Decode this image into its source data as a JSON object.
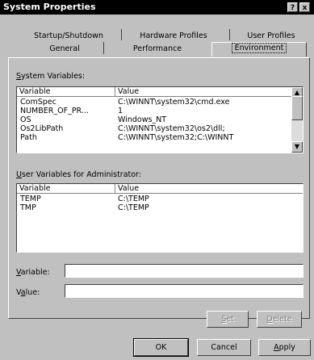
{
  "window": {
    "title": "System Properties",
    "help_glyph": "?",
    "close_glyph": "x"
  },
  "tabs": {
    "row_back": [
      "Startup/Shutdown",
      "Hardware Profiles",
      "User Profiles"
    ],
    "row_front": [
      "General",
      "Performance",
      "Environment"
    ],
    "selected": "Environment"
  },
  "system_vars": {
    "label": "System Variables:",
    "headers": [
      "Variable",
      "Value"
    ],
    "rows": [
      {
        "var": "ComSpec",
        "val": "C:\\WINNT\\system32\\cmd.exe"
      },
      {
        "var": "NUMBER_OF_PR...",
        "val": "1"
      },
      {
        "var": "OS",
        "val": "Windows_NT"
      },
      {
        "var": "Os2LibPath",
        "val": "C:\\WINNT\\system32\\os2\\dll;"
      },
      {
        "var": "Path",
        "val": "C:\\WINNT\\system32;C:\\WINNT"
      }
    ]
  },
  "user_vars": {
    "label": "User Variables for Administrator:",
    "headers": [
      "Variable",
      "Value"
    ],
    "rows": [
      {
        "var": "TEMP",
        "val": "C:\\TEMP"
      },
      {
        "var": "TMP",
        "val": "C:\\TEMP"
      }
    ]
  },
  "fields": {
    "variable_label": "Variable:",
    "variable_value": "",
    "value_label": "Value:",
    "value_value": ""
  },
  "buttons": {
    "set": "Set",
    "delete": "Delete",
    "ok": "OK",
    "cancel": "Cancel",
    "apply": "Apply"
  },
  "icons": {
    "scroll_up": "up-arrow-icon",
    "scroll_down": "down-arrow-icon"
  }
}
